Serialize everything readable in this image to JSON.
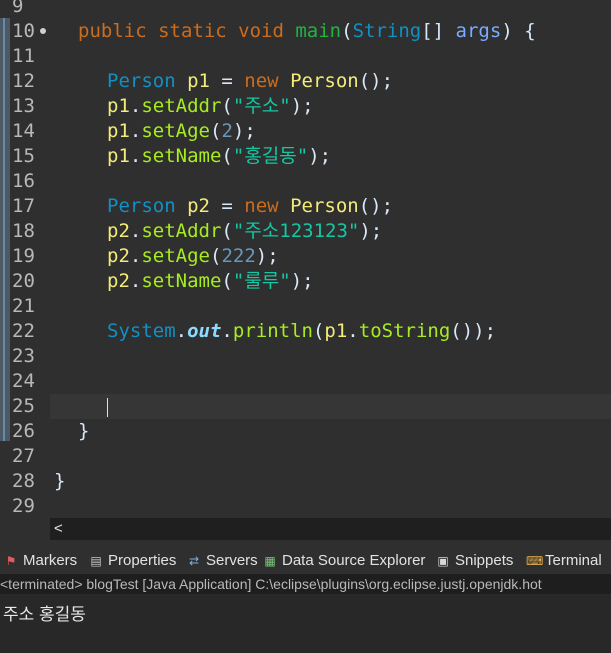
{
  "editor": {
    "lines": [
      {
        "num": "9"
      },
      {
        "num": "10",
        "fold": true,
        "tokens": [
          [
            "kw",
            "public "
          ],
          [
            "kw",
            "static "
          ],
          [
            "kw",
            "void "
          ],
          [
            "mth",
            "main"
          ],
          [
            "plain",
            "("
          ],
          [
            "type",
            "String"
          ],
          [
            "plain",
            "[] "
          ],
          [
            "param",
            "args"
          ],
          [
            "plain",
            ") {"
          ]
        ]
      },
      {
        "num": "11"
      },
      {
        "num": "12",
        "tokens": [
          [
            "type",
            "Person "
          ],
          [
            "lvar",
            "p1"
          ],
          [
            "plain",
            " = "
          ],
          [
            "kw",
            "new "
          ],
          [
            "lvar",
            "Person"
          ],
          [
            "plain",
            "();"
          ]
        ]
      },
      {
        "num": "13",
        "tokens": [
          [
            "lvar",
            "p1"
          ],
          [
            "plain",
            "."
          ],
          [
            "call",
            "setAddr"
          ],
          [
            "plain",
            "("
          ],
          [
            "str",
            "\"주소\""
          ],
          [
            "plain",
            ");"
          ]
        ]
      },
      {
        "num": "14",
        "tokens": [
          [
            "lvar",
            "p1"
          ],
          [
            "plain",
            "."
          ],
          [
            "call",
            "setAge"
          ],
          [
            "plain",
            "("
          ],
          [
            "num",
            "2"
          ],
          [
            "plain",
            ");"
          ]
        ]
      },
      {
        "num": "15",
        "tokens": [
          [
            "lvar",
            "p1"
          ],
          [
            "plain",
            "."
          ],
          [
            "call",
            "setName"
          ],
          [
            "plain",
            "("
          ],
          [
            "str",
            "\"홍길동\""
          ],
          [
            "plain",
            ");"
          ]
        ]
      },
      {
        "num": "16"
      },
      {
        "num": "17",
        "tokens": [
          [
            "type",
            "Person "
          ],
          [
            "lvar",
            "p2"
          ],
          [
            "plain",
            " = "
          ],
          [
            "kw",
            "new "
          ],
          [
            "lvar",
            "Person"
          ],
          [
            "plain",
            "();"
          ]
        ]
      },
      {
        "num": "18",
        "tokens": [
          [
            "lvar",
            "p2"
          ],
          [
            "plain",
            "."
          ],
          [
            "call",
            "setAddr"
          ],
          [
            "plain",
            "("
          ],
          [
            "str",
            "\"주소123123\""
          ],
          [
            "plain",
            ");"
          ]
        ]
      },
      {
        "num": "19",
        "tokens": [
          [
            "lvar",
            "p2"
          ],
          [
            "plain",
            "."
          ],
          [
            "call",
            "setAge"
          ],
          [
            "plain",
            "("
          ],
          [
            "num",
            "222"
          ],
          [
            "plain",
            ");"
          ]
        ]
      },
      {
        "num": "20",
        "tokens": [
          [
            "lvar",
            "p2"
          ],
          [
            "plain",
            "."
          ],
          [
            "call",
            "setName"
          ],
          [
            "plain",
            "("
          ],
          [
            "str",
            "\"룰루\""
          ],
          [
            "plain",
            ");"
          ]
        ]
      },
      {
        "num": "21"
      },
      {
        "num": "22",
        "tokens": [
          [
            "type",
            "System"
          ],
          [
            "plain",
            "."
          ],
          [
            "fld",
            "out"
          ],
          [
            "plain",
            "."
          ],
          [
            "call",
            "println"
          ],
          [
            "plain",
            "("
          ],
          [
            "lvar",
            "p1"
          ],
          [
            "plain",
            "."
          ],
          [
            "call",
            "toString"
          ],
          [
            "plain",
            "());"
          ]
        ]
      },
      {
        "num": "23"
      },
      {
        "num": "24"
      },
      {
        "num": "25",
        "current": true
      },
      {
        "num": "26",
        "tokens": [
          [
            "plain",
            "}"
          ]
        ]
      },
      {
        "num": "27"
      },
      {
        "num": "28",
        "tokens": [
          [
            "plain",
            "}"
          ]
        ]
      },
      {
        "num": "29"
      }
    ]
  },
  "hscroll": {
    "arrow": "<"
  },
  "views": {
    "tabs": [
      {
        "label": "Markers",
        "icon": "markers-icon"
      },
      {
        "label": "Properties",
        "icon": "properties-icon"
      },
      {
        "label": "Servers",
        "icon": "servers-icon"
      },
      {
        "label": "Data Source Explorer",
        "icon": "data-source-icon"
      },
      {
        "label": "Snippets",
        "icon": "snippets-icon"
      },
      {
        "label": "Terminal",
        "icon": "terminal-icon"
      }
    ]
  },
  "console": {
    "status": "<terminated> blogTest [Java Application] C:\\eclipse\\plugins\\org.eclipse.justj.openjdk.hot",
    "output": "주소 홍길동"
  },
  "colors": {
    "keyword": "#cc6c1d",
    "type": "#1290c3",
    "string": "#17c6a3",
    "number": "#6897bb",
    "local_variable": "#f3ec79",
    "method": "#a7ec21",
    "background": "#2f2f2f"
  }
}
